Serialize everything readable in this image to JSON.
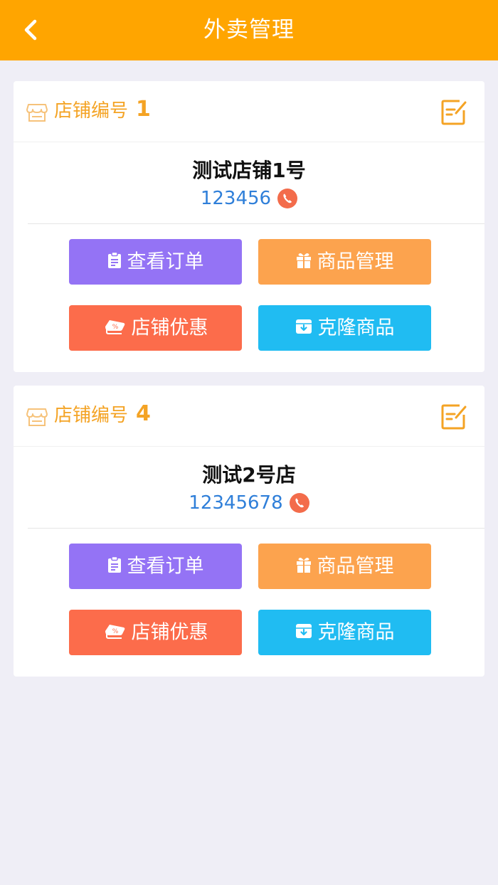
{
  "header": {
    "title": "外卖管理",
    "background": "#ffa500"
  },
  "stores": [
    {
      "number_label": "店铺编号",
      "number": "1",
      "name": "测试店铺1号",
      "phone": "123456",
      "buttons": {
        "orders": "查看订单",
        "goods": "商品管理",
        "promo": "店铺优惠",
        "clone": "克隆商品"
      }
    },
    {
      "number_label": "店铺编号",
      "number": "4",
      "name": "测试2号店",
      "phone": "12345678",
      "buttons": {
        "orders": "查看订单",
        "goods": "商品管理",
        "promo": "店铺优惠",
        "clone": "克隆商品"
      }
    }
  ],
  "icons": {
    "back": "chevron-left-icon",
    "store": "store-icon",
    "edit": "edit-icon",
    "phone": "phone-icon",
    "orders": "clipboard-icon",
    "goods": "gift-icon",
    "promo": "coupon-icon",
    "clone": "archive-icon"
  },
  "colors": {
    "accent": "#f4a324",
    "orders_button": "#9473f5",
    "goods_button": "#fca34e",
    "promo_button": "#fc6c4b",
    "clone_button": "#20bcf2",
    "phone_text": "#2f7fd9",
    "phone_icon": "#f36c4b"
  }
}
